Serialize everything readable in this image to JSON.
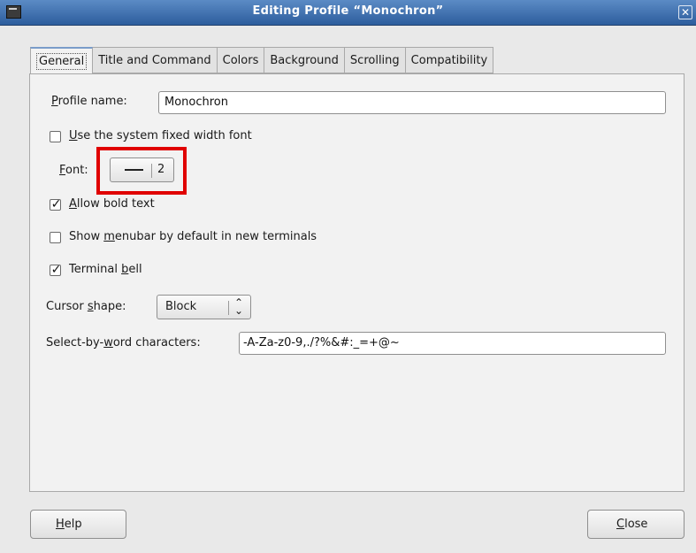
{
  "window": {
    "title": "Editing Profile “Monochron”",
    "close_glyph": "✕",
    "app_icon": "terminal-icon"
  },
  "tabs": [
    {
      "label": "General",
      "active": true
    },
    {
      "label": "Title and Command",
      "active": false
    },
    {
      "label": "Colors",
      "active": false
    },
    {
      "label": "Background",
      "active": false
    },
    {
      "label": "Scrolling",
      "active": false
    },
    {
      "label": "Compatibility",
      "active": false
    }
  ],
  "general": {
    "profile_name": {
      "label_mnemonic": "P",
      "label_rest": "rofile name:",
      "value": "Monochron"
    },
    "system_font": {
      "mn": "U",
      "rest": "se the system fixed width font",
      "checked": false
    },
    "font": {
      "label_mnemonic": "F",
      "label_rest": "ont:",
      "size": "2"
    },
    "allow_bold": {
      "mn": "A",
      "rest": "llow bold text",
      "checked": true,
      "check_glyph": "✓"
    },
    "show_menubar": {
      "pre": "Show ",
      "mn": "m",
      "rest": "enubar by default in new terminals",
      "checked": false
    },
    "terminal_bell": {
      "pre": "Terminal ",
      "mn": "b",
      "rest": "ell",
      "checked": true,
      "check_glyph": "✓"
    },
    "cursor_shape": {
      "pre": "Cursor ",
      "mn": "s",
      "rest": "hape:",
      "value": "Block",
      "arrows": "⌃\n⌄"
    },
    "select_by_word": {
      "pre": "Select-by-",
      "mn": "w",
      "rest": "ord characters:",
      "value": "-A-Za-z0-9,./?%&#:_=+@~"
    }
  },
  "buttons": {
    "help": {
      "mn": "H",
      "rest": "elp"
    },
    "close": {
      "mn": "C",
      "rest": "lose"
    }
  },
  "annotation": {
    "color": "#e00000"
  }
}
